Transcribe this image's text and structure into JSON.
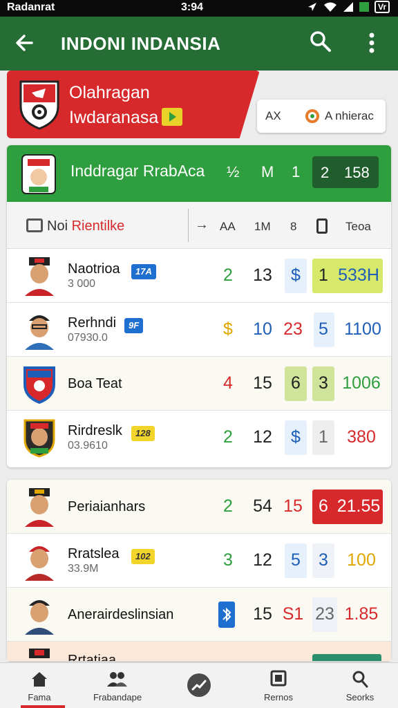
{
  "status_bar": {
    "carrier": "Radanrat",
    "time": "3:94",
    "battery": "Vr"
  },
  "app_bar": {
    "title": "INDONI INDANSIA",
    "back_icon": "arrow-left-icon",
    "search_icon": "search-icon",
    "more_icon": "more-vert-icon"
  },
  "hero": {
    "title": "Olahragan",
    "subtitle": "Iwdaranasa",
    "filter_left": "AX",
    "filter_right": "A nhierac"
  },
  "team_header": {
    "name": "Inddragar RrabAca",
    "cols": [
      "½",
      "M",
      "1"
    ],
    "box_a": "2",
    "box_b": "158"
  },
  "column_header": {
    "label_pre": "Noi",
    "label_main": "Rientilke",
    "cols": [
      "AA",
      "1M",
      "8",
      "Teoa"
    ]
  },
  "rows": [
    {
      "name": "Naotrioa",
      "sub": "3 000",
      "tag": "17A",
      "tag_color": "blue",
      "c1": "2",
      "c2": "13",
      "c3": "$",
      "c4": "1",
      "c5": "533H"
    },
    {
      "name": "Rerhndi",
      "sub": "07930.0",
      "tag": "9F",
      "tag_color": "blue",
      "c1": "$",
      "c2": "10",
      "c3": "23",
      "c4": "5",
      "c5": "1100"
    },
    {
      "name": "Boa Teat",
      "sub": "",
      "tag": "",
      "tag_color": "",
      "c1": "4",
      "c2": "15",
      "c3": "6",
      "c4": "3",
      "c5": "1006"
    },
    {
      "name": "Rirdreslk",
      "sub": "03.9610",
      "tag": "128",
      "tag_color": "yellow",
      "c1": "2",
      "c2": "12",
      "c3": "$",
      "c4": "1",
      "c5": "380"
    },
    {
      "name": "Periaianhars",
      "sub": "",
      "tag": "",
      "tag_color": "",
      "c1": "2",
      "c2": "54",
      "c3": "15",
      "c4": "6",
      "c5": "21.55"
    },
    {
      "name": "Rratslea",
      "sub": "33.9M",
      "tag": "102",
      "tag_color": "yellow",
      "c1": "3",
      "c2": "12",
      "c3": "5",
      "c4": "3",
      "c5": "100"
    },
    {
      "name": "Anerairdeslinsian",
      "sub": "",
      "tag": "",
      "tag_color": "",
      "c1": "",
      "c2": "15",
      "c3": "S1",
      "c4": "23",
      "c5": "1.85"
    },
    {
      "name": "Rrtatiaa",
      "sub": "",
      "tag": "",
      "tag_color": "",
      "c1": "",
      "c2": "",
      "c3": "",
      "c4": "",
      "c5": ""
    }
  ],
  "bottom_nav": [
    {
      "label": "Fama",
      "icon": "home-icon"
    },
    {
      "label": "Frabandape",
      "icon": "people-icon"
    },
    {
      "label": "",
      "icon": "trending-icon"
    },
    {
      "label": "Rernos",
      "icon": "box-icon"
    },
    {
      "label": "Seorks",
      "icon": "search-icon"
    }
  ],
  "colors": {
    "app_bar": "#256d35",
    "team_header": "#2e9e3e",
    "hero": "#d7292b"
  }
}
